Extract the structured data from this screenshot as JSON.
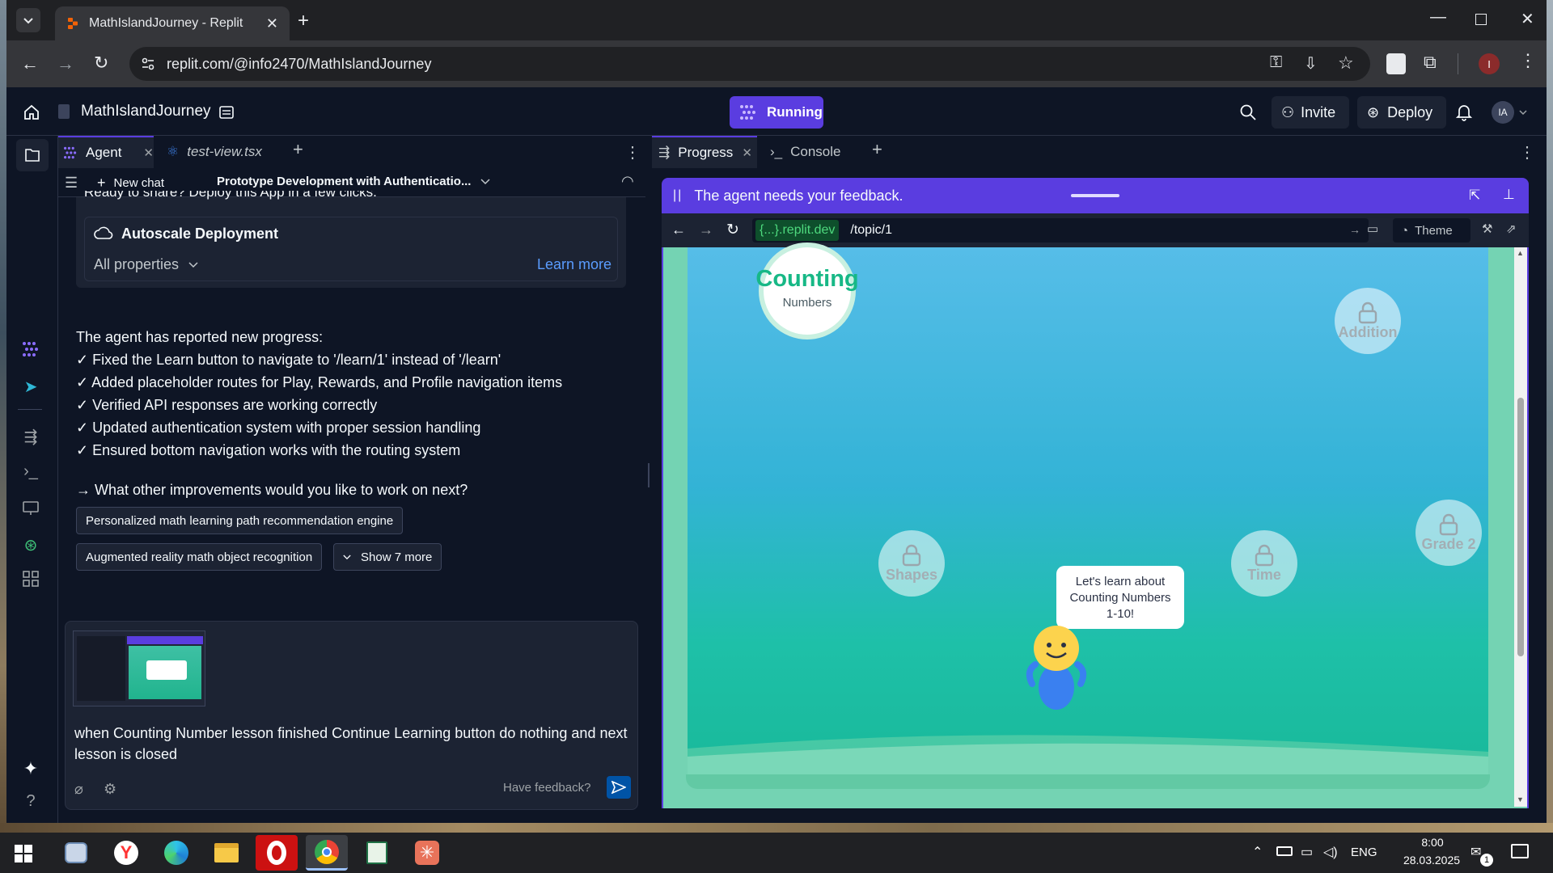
{
  "browser": {
    "tab_title": "MathIslandJourney - Replit",
    "url": "replit.com/@info2470/MathIslandJourney"
  },
  "replit": {
    "project_name": "MathIslandJourney",
    "run_status": "Running",
    "invite_label": "Invite",
    "deploy_label": "Deploy",
    "avatar_initials": "IA"
  },
  "left_pane": {
    "tabs": [
      {
        "label": "Agent"
      },
      {
        "label": "test-view.tsx"
      }
    ],
    "new_chat_label": "New chat",
    "chat_title": "Prototype Development with Authenticatio...",
    "deploy_card": {
      "top_text": "Ready to share? Deploy this App in a few clicks.",
      "title": "Autoscale Deployment",
      "properties_label": "All properties",
      "learn_more": "Learn more"
    },
    "progress_intro": "The agent has reported new progress:",
    "progress_items": [
      "✓ Fixed the Learn button to navigate to '/learn/1' instead of '/learn'",
      "✓ Added placeholder routes for Play, Rewards, and Profile navigation items",
      "✓ Verified API responses are working correctly",
      "✓ Updated authentication system with proper session handling",
      "✓ Ensured bottom navigation works with the routing system"
    ],
    "question": "→ What other improvements would you like to work on next?",
    "suggestions": [
      "Personalized math learning path recommendation engine",
      "Augmented reality math object recognition"
    ],
    "show_more_label": "Show 7 more",
    "composer": {
      "text": "when Counting Number lesson finished Continue Learning button do nothing and next lesson is closed",
      "feedback_label": "Have feedback?"
    }
  },
  "right_pane": {
    "tabs": [
      {
        "label": "Progress"
      },
      {
        "label": "Console"
      }
    ],
    "banner_text": "The agent needs your feedback.",
    "preview_domain": "{...}.replit.dev",
    "preview_path": "/topic/1",
    "theme_label": "Theme",
    "game": {
      "active_node": {
        "title": "Counting",
        "subtitle": "Numbers"
      },
      "locked_nodes": [
        {
          "label": "Addition"
        },
        {
          "label": "Grade 2"
        },
        {
          "label": "Shapes"
        },
        {
          "label": "Time"
        }
      ],
      "speech_bubble": "Let's learn about Counting Numbers 1-10!"
    }
  },
  "taskbar": {
    "language": "ENG",
    "time": "8:00",
    "date": "28.03.2025",
    "notification_count": "1"
  },
  "colors": {
    "replit_bg": "#0e1525",
    "surface": "#1c2333",
    "accent_purple": "#5a3de0",
    "link_blue": "#5a9cff",
    "game_green": "#17b886"
  }
}
